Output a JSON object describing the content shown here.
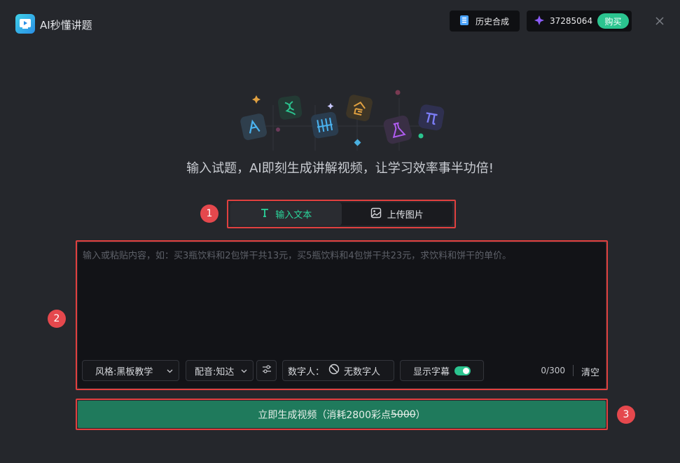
{
  "app": {
    "title": "AI秒懂讲题"
  },
  "header": {
    "history_label": "历史合成",
    "points": "37285064",
    "buy_label": "购买"
  },
  "tagline": "输入试题，AI即刻生成讲解视频，让学习效率事半功倍!",
  "tabs": [
    {
      "label": "输入文本",
      "active": true
    },
    {
      "label": "上传图片",
      "active": false
    }
  ],
  "editor": {
    "value": "",
    "placeholder": "输入或粘贴内容，如：买3瓶饮料和2包饼干共13元，买5瓶饮料和4包饼干共23元，求饮料和饼干的单价。",
    "style_select": "风格:黑板教学",
    "voice_select": "配音:知达",
    "avatar_label": "数字人：",
    "avatar_value": "无数字人",
    "subtitle_label": "显示字幕",
    "subtitle_on": true,
    "counter": "0/300",
    "clear_label": "清空"
  },
  "generate": {
    "label": "立即生成视频（消耗2800彩点 ",
    "original_cost": "5000",
    "close_paren": "）"
  },
  "annotations": [
    "1",
    "2",
    "3"
  ],
  "colors": {
    "accent": "#2bc48f",
    "highlight_box": "#e0403f",
    "background": "#25272c"
  }
}
